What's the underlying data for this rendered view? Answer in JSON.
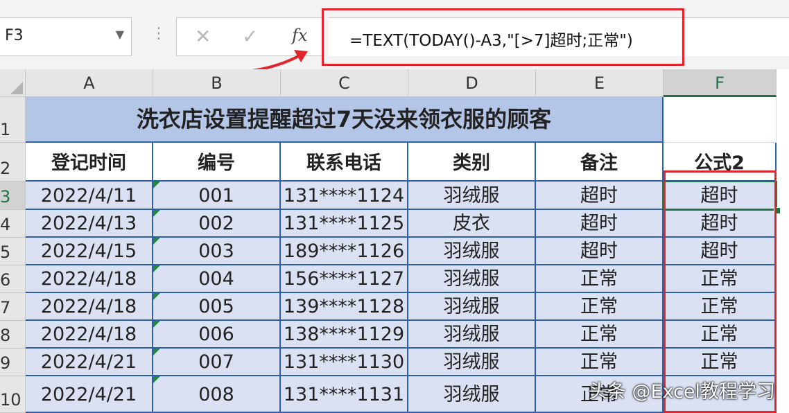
{
  "name_box": {
    "value": "F3",
    "dropdown_icon": "chevron-down-icon"
  },
  "formula_bar": {
    "cancel_icon": "cancel-x-icon",
    "enter_icon": "check-icon",
    "fx_label": "fx",
    "formula": "=TEXT(TODAY()-A3,\"[>7]超时;正常\")"
  },
  "columns": [
    "A",
    "B",
    "C",
    "D",
    "E",
    "F"
  ],
  "rows": [
    "1",
    "2",
    "3",
    "4",
    "5",
    "6",
    "7",
    "8",
    "9",
    "10"
  ],
  "title": "洗衣店设置提醒超过7天没来领衣服的顾客",
  "headers": [
    "登记时间",
    "编号",
    "联系电话",
    "类别",
    "备注",
    "公式2"
  ],
  "data_rows": [
    [
      "2022/4/11",
      "001",
      "131****1124",
      "羽绒服",
      "超时",
      "超时"
    ],
    [
      "2022/4/13",
      "002",
      "131****1125",
      "皮衣",
      "超时",
      "超时"
    ],
    [
      "2022/4/15",
      "003",
      "189****1126",
      "羽绒服",
      "超时",
      "超时"
    ],
    [
      "2022/4/18",
      "004",
      "156****1127",
      "羽绒服",
      "正常",
      "正常"
    ],
    [
      "2022/4/18",
      "005",
      "139****1128",
      "羽绒服",
      "正常",
      "正常"
    ],
    [
      "2022/4/18",
      "006",
      "138****1129",
      "羽绒服",
      "正常",
      "正常"
    ],
    [
      "2022/4/21",
      "007",
      "131****1130",
      "羽绒服",
      "正常",
      "正常"
    ],
    [
      "2022/4/21",
      "008",
      "131****1131",
      "羽绒服",
      "正常",
      ""
    ]
  ],
  "selected_cell": "F3",
  "watermark": "头条 @Excel教程学习",
  "colors": {
    "accent_green": "#217346",
    "annotation_red": "#e0262b",
    "title_fill": "#b4c6e7",
    "data_fill": "#d9e1f2",
    "border_blue": "#2e5fa8"
  }
}
